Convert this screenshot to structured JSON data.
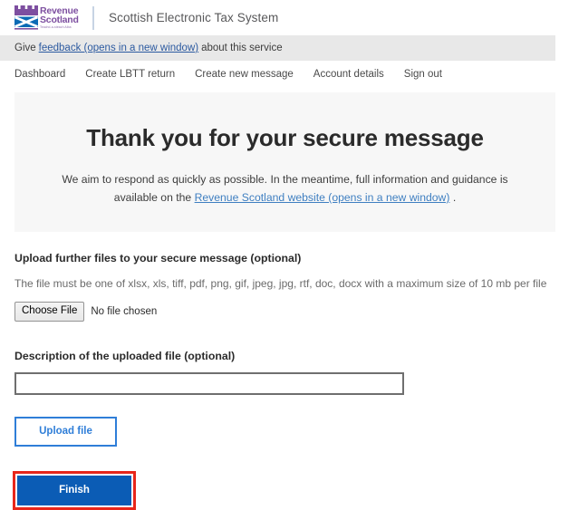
{
  "header": {
    "logo": {
      "line1": "Revenue",
      "line2": "Scotland",
      "line3": "Teachd-a-steach Alba",
      "crown_color": "#7d4fa0",
      "saltire_bg": "#0b6bb5"
    },
    "title": "Scottish Electronic Tax System"
  },
  "feedback": {
    "prefix": "Give",
    "link": "feedback (opens in a new window)",
    "suffix": "about this service"
  },
  "nav": {
    "items": [
      {
        "label": "Dashboard"
      },
      {
        "label": "Create LBTT return"
      },
      {
        "label": "Create new message"
      },
      {
        "label": "Account details"
      },
      {
        "label": "Sign out"
      }
    ]
  },
  "panel": {
    "heading": "Thank you for your secure message",
    "body_before": "We aim to respond as quickly as possible. In the meantime, full information and guidance is available on the",
    "body_link": "Revenue Scotland website (opens in a new window)",
    "body_after": "."
  },
  "form": {
    "upload_label": "Upload further files to your secure message (optional)",
    "upload_hint": "The file must be one of xlsx, xls, tiff, pdf, png, gif, jpeg, jpg, rtf, doc, docx with a maximum size of 10 mb per file",
    "choose_file_label": "Choose File",
    "file_status": "No file chosen",
    "description_label": "Description of the uploaded file (optional)",
    "description_value": "",
    "description_placeholder": "",
    "upload_button": "Upload file",
    "finish_button": "Finish"
  },
  "colors": {
    "accent_blue": "#2f7ed8",
    "primary_blue": "#0b5cb5",
    "highlight_red": "#e8261a",
    "link_blue": "#3f7fc1",
    "panel_grey": "#f7f7f7",
    "bar_grey": "#e8e8e8"
  }
}
